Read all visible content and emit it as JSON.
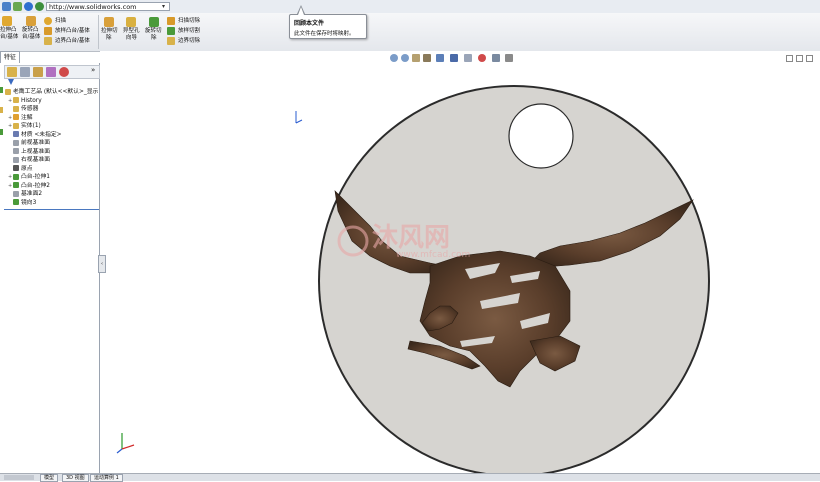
{
  "browser": {
    "url": "http://www.solidworks.com",
    "dropdown_icon": "chevron-down-icon"
  },
  "ribbon": {
    "groups": [
      {
        "top": "拉伸凸",
        "bottom": "台/基体"
      },
      {
        "top": "旋转凸",
        "bottom": "台/基体"
      }
    ],
    "sweep": "扫描",
    "loft": "放样凸台/基体",
    "boundary": "边界凸台/基体",
    "cut_extrude": {
      "top": "拉伸切",
      "bottom": "除"
    },
    "hole_wizard": {
      "top": "异型孔",
      "bottom": "向导"
    },
    "cut_revolve": {
      "top": "旋转切",
      "bottom": "除"
    },
    "cut_sweep": "扫描切除",
    "cut_loft": "放样切割",
    "cut_boundary": "边界切除"
  },
  "tooltip": {
    "title": "回顾本文件",
    "description": "此文件在保存时将映射。"
  },
  "feature_tab": "特征",
  "tree": {
    "root": "老鹰工艺品 (默认<<默认>_显示",
    "items": [
      {
        "label": "History",
        "expand": "+",
        "icon": "history-icon",
        "color": "#d8b24a"
      },
      {
        "label": "传感器",
        "expand": "",
        "icon": "sensor-icon",
        "color": "#d8b24a"
      },
      {
        "label": "注解",
        "expand": "+",
        "icon": "annotation-icon",
        "color": "#e0a030"
      },
      {
        "label": "实体(1)",
        "expand": "+",
        "icon": "solid-bodies-icon",
        "color": "#d8b24a"
      },
      {
        "label": "材质 <未指定>",
        "expand": "",
        "icon": "material-icon",
        "color": "#6a7bb0"
      },
      {
        "label": "前视基准面",
        "expand": "",
        "icon": "plane-icon",
        "color": "#9aa0aa"
      },
      {
        "label": "上视基准面",
        "expand": "",
        "icon": "plane-icon",
        "color": "#9aa0aa"
      },
      {
        "label": "右视基准面",
        "expand": "",
        "icon": "plane-icon",
        "color": "#9aa0aa"
      },
      {
        "label": "原点",
        "expand": "",
        "icon": "origin-icon",
        "color": "#555555"
      },
      {
        "label": "凸台-拉伸1",
        "expand": "+",
        "icon": "extrude-icon",
        "color": "#4a9a3a"
      },
      {
        "label": "凸台-拉伸2",
        "expand": "+",
        "icon": "extrude-icon",
        "color": "#4a9a3a"
      },
      {
        "label": "基准面2",
        "expand": "",
        "icon": "plane-icon",
        "color": "#9aa0aa"
      },
      {
        "label": "镜向3",
        "expand": "",
        "icon": "mirror-icon",
        "color": "#4a9a3a"
      }
    ]
  },
  "watermark": {
    "cn": "沐风网",
    "url": "www.mfcad.com"
  },
  "bottom_tabs": [
    "模型",
    "3D 视图",
    "运动算例 1"
  ],
  "colors": {
    "plate": "#d6d4d0",
    "eagle": "#5a3e2b",
    "selection_line": "#4a78c0",
    "watermark": "#e8a8a8"
  }
}
